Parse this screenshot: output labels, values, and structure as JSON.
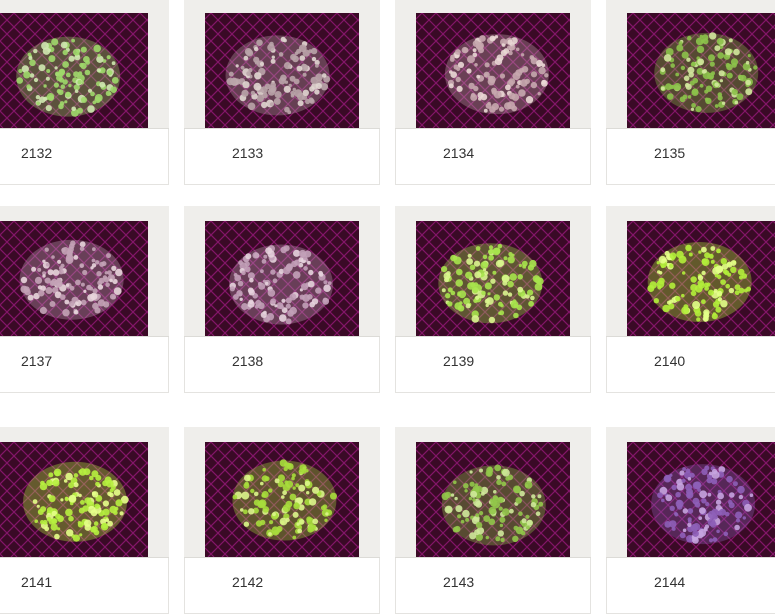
{
  "colors": {
    "frame": "#efeeeb",
    "photo_bg": "#3a0a26",
    "grid": "#c020a0"
  },
  "items": [
    {
      "label": "2132",
      "coral": "#9fd86a",
      "tip": "#cfe8b0"
    },
    {
      "label": "2133",
      "coral": "#b9a4a8",
      "tip": "#e0d6d0"
    },
    {
      "label": "2134",
      "coral": "#c6a7ae",
      "tip": "#ead8d5"
    },
    {
      "label": "2135",
      "coral": "#8cc24a",
      "tip": "#d2e89c"
    },
    {
      "label": "2137",
      "coral": "#c3a2b6",
      "tip": "#e8d5dc"
    },
    {
      "label": "2138",
      "coral": "#c2a0b8",
      "tip": "#e6d3dd"
    },
    {
      "label": "2139",
      "coral": "#a7e34c",
      "tip": "#d9f58e"
    },
    {
      "label": "2140",
      "coral": "#b3ee3a",
      "tip": "#e3ff88"
    },
    {
      "label": "2141",
      "coral": "#b6f03f",
      "tip": "#e6ff8a"
    },
    {
      "label": "2142",
      "coral": "#a7dd3c",
      "tip": "#dcf58b"
    },
    {
      "label": "2143",
      "coral": "#92c64a",
      "tip": "#cfe99a"
    },
    {
      "label": "2144",
      "coral": "#8e5fb8",
      "tip": "#c7a4e0"
    }
  ]
}
